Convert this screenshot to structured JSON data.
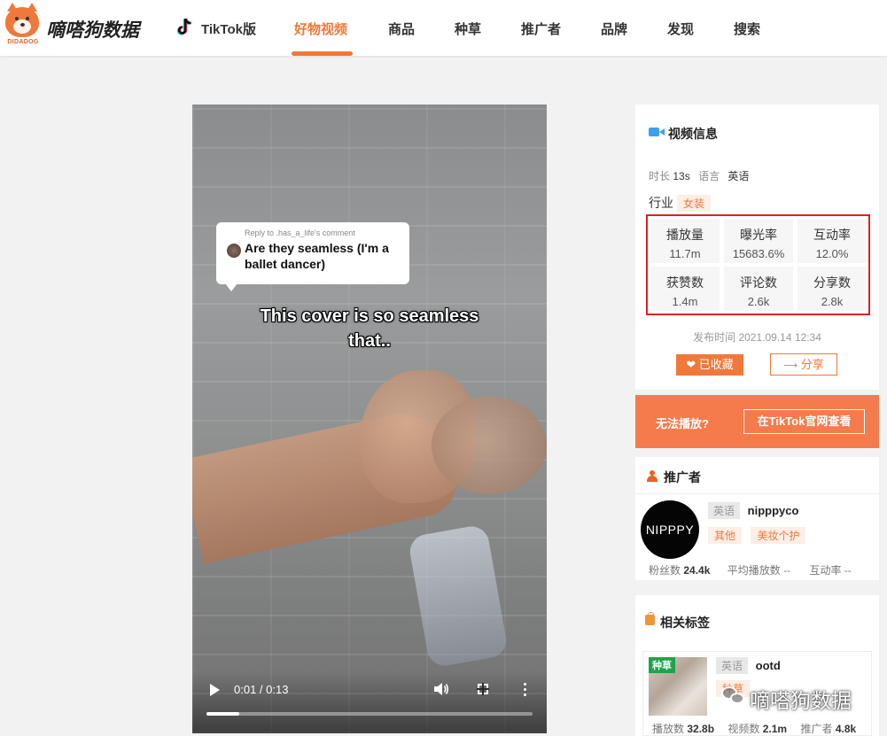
{
  "header": {
    "logo_text": "DIDADOG",
    "brand": "嘀嗒狗数据",
    "nav": [
      {
        "label": "TikTok版",
        "active": false
      },
      {
        "label": "好物视频",
        "active": true
      },
      {
        "label": "商品",
        "active": false
      },
      {
        "label": "种草",
        "active": false
      },
      {
        "label": "推广者",
        "active": false
      },
      {
        "label": "品牌",
        "active": false
      },
      {
        "label": "发现",
        "active": false
      },
      {
        "label": "搜索",
        "active": false
      }
    ],
    "accent_color": "#f0783a"
  },
  "video": {
    "comment_reply_to": "Reply to .has_a_life's comment",
    "comment_text": "Are they seamless (I'm a ballet dancer)",
    "caption": "This cover is so seamless that..",
    "time_display": "0:01 / 0:13",
    "progress": 0.1,
    "controls": {
      "play": "play-icon",
      "volume": "volume-icon",
      "fullscreen": "fullscreen-icon",
      "more": "more-icon"
    }
  },
  "video_info": {
    "title": "视频信息",
    "duration_label": "时长",
    "duration": "13s",
    "language_label": "语言",
    "language": "英语",
    "industry_label": "行业",
    "industry": "女装",
    "stats": [
      {
        "label": "播放量",
        "value": "11.7m"
      },
      {
        "label": "曝光率",
        "value": "15683.6%"
      },
      {
        "label": "互动率",
        "value": "12.0%"
      },
      {
        "label": "获赞数",
        "value": "1.4m"
      },
      {
        "label": "评论数",
        "value": "2.6k"
      },
      {
        "label": "分享数",
        "value": "2.8k"
      }
    ],
    "publish_time": "发布时间 2021.09.14 12:34",
    "favorite_button": "已收藏",
    "share_button": "分享"
  },
  "banner": {
    "text": "无法播放?",
    "button": "在TikTok官网查看"
  },
  "promoter": {
    "title": "推广者",
    "avatar_text": "NIPPPY",
    "language": "英语",
    "name": "nipppyco",
    "tags": [
      "其他",
      "美妆个护"
    ],
    "followers_label": "粉丝数",
    "followers": "24.4k",
    "avg_play_label": "平均播放数",
    "avg_play": "--",
    "engagement_label": "互动率",
    "engagement": "--"
  },
  "related_tags": {
    "title": "相关标签",
    "card": {
      "badge": "种草",
      "language": "英语",
      "name": "ootd",
      "type_partial": "种草",
      "plays_label": "播放数",
      "plays": "32.8b",
      "videos_label": "视频数",
      "videos": "2.1m",
      "promoters_label": "推广者",
      "promoters": "4.8k"
    }
  },
  "watermark": {
    "text": "嘀嗒狗数据"
  }
}
